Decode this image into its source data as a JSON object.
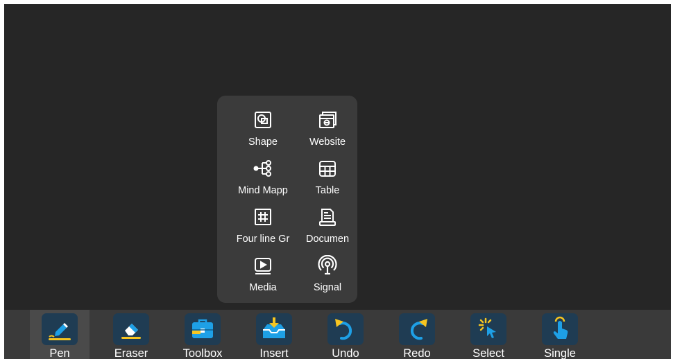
{
  "popup": {
    "items": [
      {
        "label": "Shape",
        "icon": "shape-icon"
      },
      {
        "label": "Website",
        "icon": "website-icon"
      },
      {
        "label": "Mind Mapp",
        "icon": "mind-map-icon"
      },
      {
        "label": "Table",
        "icon": "table-icon"
      },
      {
        "label": "Four line Gr",
        "icon": "four-line-grid-icon"
      },
      {
        "label": "Documen",
        "icon": "document-icon"
      },
      {
        "label": "Media",
        "icon": "media-icon"
      },
      {
        "label": "Signal",
        "icon": "signal-icon"
      }
    ]
  },
  "toolbar": {
    "tools": [
      {
        "label": "Pen",
        "icon": "pen-icon",
        "active": true
      },
      {
        "label": "Eraser",
        "icon": "eraser-icon"
      },
      {
        "label": "Toolbox",
        "icon": "toolbox-icon"
      },
      {
        "label": "Insert",
        "icon": "insert-icon"
      },
      {
        "label": "Undo",
        "icon": "undo-icon"
      },
      {
        "label": "Redo",
        "icon": "redo-icon"
      },
      {
        "label": "Select",
        "icon": "select-icon"
      },
      {
        "label": "Single",
        "icon": "single-touch-icon"
      }
    ]
  },
  "colors": {
    "background": "#262626",
    "toolbar": "#3a3a3a",
    "popup": "#3b3b3b",
    "icon_tile": "#1f3c53",
    "accent_blue": "#1ea0e6",
    "accent_yellow": "#f7c520"
  }
}
